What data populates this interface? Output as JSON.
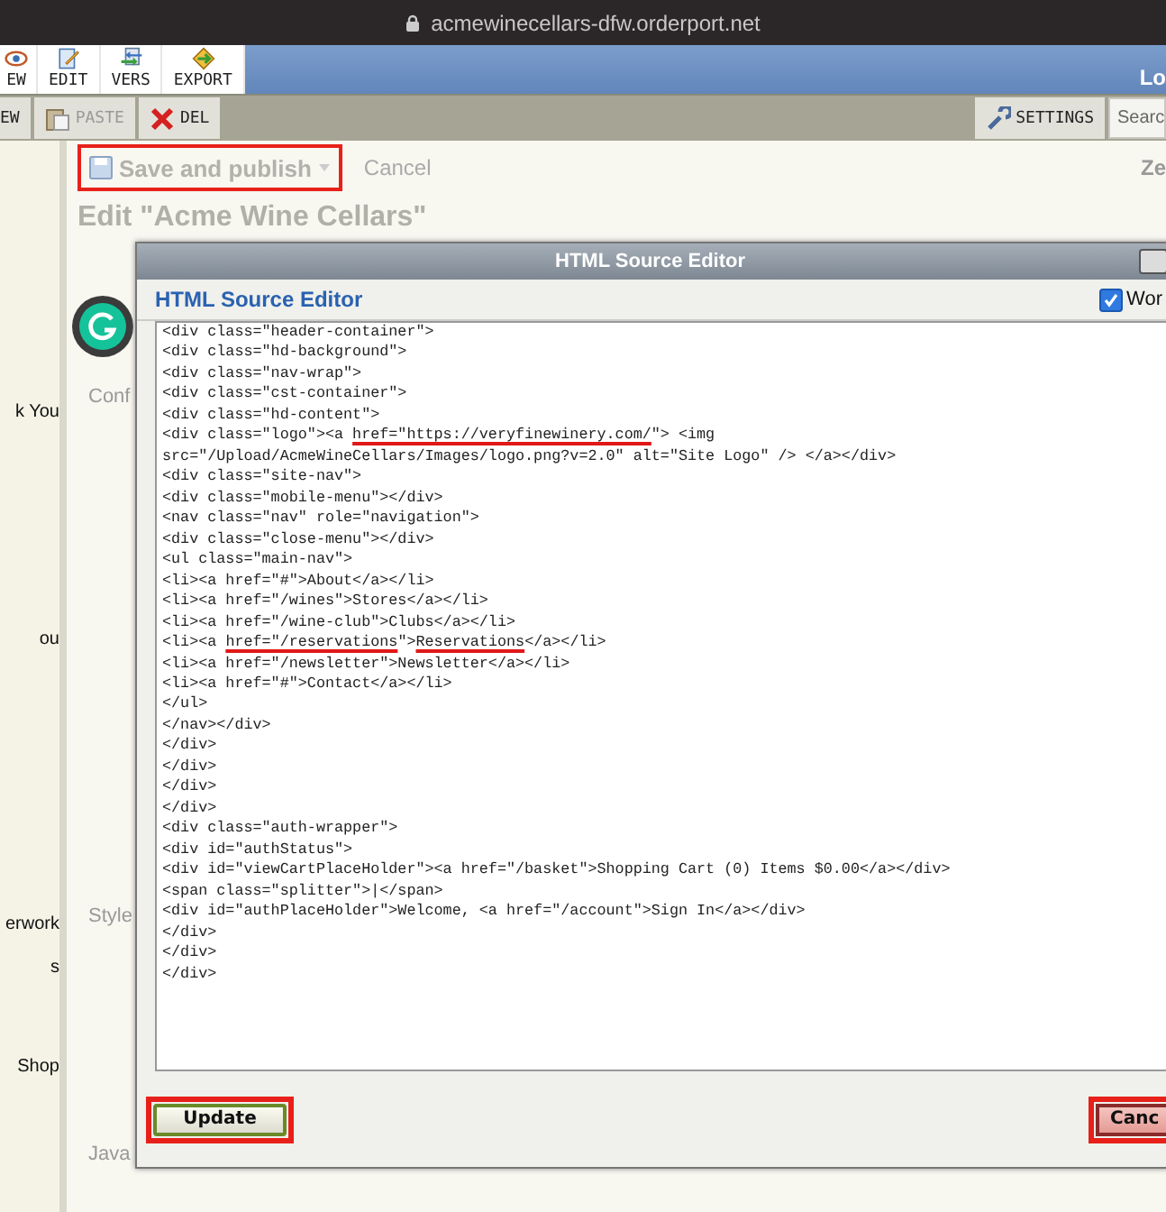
{
  "browser": {
    "url": "acmewinecellars-dfw.orderport.net"
  },
  "toolbar": {
    "buttons": [
      {
        "label": "EW",
        "kind": "view"
      },
      {
        "label": "EDIT",
        "kind": "edit"
      },
      {
        "label": "VERS",
        "kind": "versions"
      },
      {
        "label": "EXPORT",
        "kind": "export"
      }
    ],
    "user_label": "Lo"
  },
  "actions": {
    "buttons": [
      {
        "label": "EW",
        "kind": "new",
        "disabled": false
      },
      {
        "label": "PASTE",
        "kind": "paste",
        "disabled": true
      },
      {
        "label": "DEL",
        "kind": "delete",
        "disabled": false
      }
    ],
    "settings": "SETTINGS",
    "search": {
      "placeholder": "Searc"
    }
  },
  "editor_bar": {
    "save": {
      "label": "Save and publish",
      "disabled": true,
      "highlighted": true
    },
    "cancel": "Cancel",
    "zoom_label": "Ze"
  },
  "sidebar": {
    "items": [
      "k You",
      "ou",
      "erwork",
      "s",
      "Shop"
    ]
  },
  "page": {
    "title": "Edit \"Acme Wine Cellars\"",
    "labels": [
      "Conf",
      "Style",
      "Java"
    ]
  },
  "dialog": {
    "title": "HTML Source Editor",
    "heading": "HTML Source Editor",
    "word_wrap": {
      "label": "Wor",
      "checked": true
    },
    "lines": [
      {
        "text": "<div class=\"header-container\">"
      },
      {
        "text": "<div class=\"hd-background\">"
      },
      {
        "text": "<div class=\"nav-wrap\">"
      },
      {
        "text": "<div class=\"cst-container\">"
      },
      {
        "text": "<div class=\"hd-content\">"
      },
      {
        "parts": [
          {
            "text": "<div class=\"logo\"><a ",
            "underlined": false
          },
          {
            "text": "href=\"https://veryfinewinery.com/",
            "underlined": true
          },
          {
            "text": "\"> <img",
            "underlined": false
          }
        ]
      },
      {
        "text": "src=\"/Upload/AcmeWineCellars/Images/logo.png?v=2.0\" alt=\"Site Logo\" /> </a></div>"
      },
      {
        "text": "<div class=\"site-nav\">"
      },
      {
        "text": "<div class=\"mobile-menu\"></div>"
      },
      {
        "text": "<nav class=\"nav\" role=\"navigation\">"
      },
      {
        "text": "<div class=\"close-menu\"></div>"
      },
      {
        "text": "<ul class=\"main-nav\">"
      },
      {
        "text": "<li><a href=\"#\">About</a></li>"
      },
      {
        "text": "<li><a href=\"/wines\">Stores</a></li>"
      },
      {
        "text": "<li><a href=\"/wine-club\">Clubs</a></li>"
      },
      {
        "parts": [
          {
            "text": "<li><a ",
            "underlined": false
          },
          {
            "text": "href=\"/reservations",
            "underlined": true
          },
          {
            "text": "\">",
            "underlined": false
          },
          {
            "text": "Reservations",
            "underlined": true
          },
          {
            "text": "</a></li>",
            "underlined": false
          }
        ]
      },
      {
        "text": "<li><a href=\"/newsletter\">Newsletter</a></li>"
      },
      {
        "text": "<li><a href=\"#\">Contact</a></li>"
      },
      {
        "text": "</ul>"
      },
      {
        "text": "</nav></div>"
      },
      {
        "text": "</div>"
      },
      {
        "text": "</div>"
      },
      {
        "text": "</div>"
      },
      {
        "text": "</div>"
      },
      {
        "text": "<div class=\"auth-wrapper\">"
      },
      {
        "text": "<div id=\"authStatus\">"
      },
      {
        "text": "<div id=\"viewCartPlaceHolder\"><a href=\"/basket\">Shopping Cart (0) Items $0.00</a></div>"
      },
      {
        "text": "<span class=\"splitter\">|</span>"
      },
      {
        "text": "<div id=\"authPlaceHolder\">Welcome, <a href=\"/account\">Sign In</a></div>"
      },
      {
        "text": "</div>"
      },
      {
        "text": "</div>"
      },
      {
        "text": "</div>"
      }
    ],
    "update": {
      "label": "Update",
      "highlighted": true
    },
    "cancel": {
      "label": "Canc",
      "highlighted": true
    }
  }
}
